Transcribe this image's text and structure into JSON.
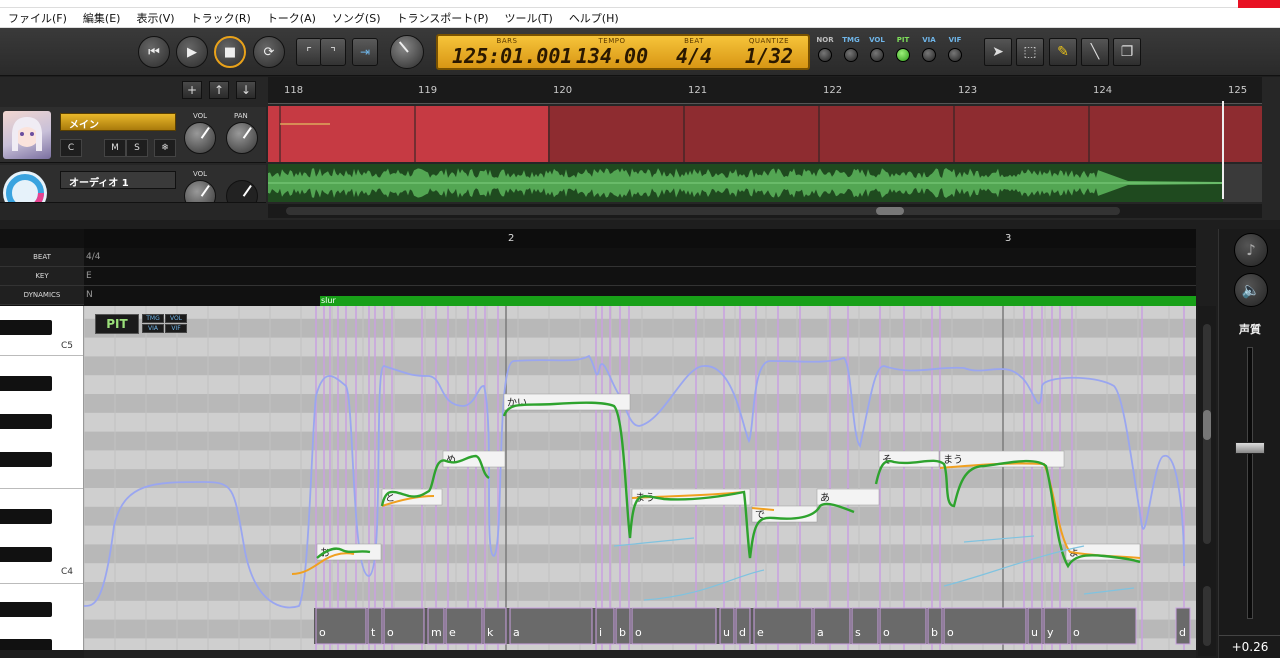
{
  "window": {
    "menu": [
      "ファイル(F)",
      "編集(E)",
      "表示(V)",
      "トラック(R)",
      "トーク(A)",
      "ソング(S)",
      "トランスポート(P)",
      "ツール(T)",
      "ヘルプ(H)"
    ]
  },
  "transport": {
    "lcd": {
      "bars_label": "BARS",
      "bars_value": "125:01.001",
      "tempo_label": "TEMPO",
      "tempo_value": "134.00",
      "beat_label": "BEAT",
      "beat_value": "4/4",
      "quantize_label": "QUANTIZE",
      "quantize_value": "1/32"
    },
    "switches": [
      {
        "label": "NOR",
        "color": "#bdbdbd",
        "on": false
      },
      {
        "label": "TMG",
        "color": "#6fb5e8",
        "on": false
      },
      {
        "label": "VOL",
        "color": "#6fb5e8",
        "on": false
      },
      {
        "label": "PIT",
        "color": "#7ee05a",
        "on": true
      },
      {
        "label": "VIA",
        "color": "#6fb5e8",
        "on": false
      },
      {
        "label": "VIF",
        "color": "#6fb5e8",
        "on": false
      }
    ]
  },
  "timeline": {
    "bars": [
      "118",
      "119",
      "120",
      "121",
      "122",
      "123",
      "124",
      "125"
    ]
  },
  "tracks": [
    {
      "name": "メイン",
      "buttons": [
        "C",
        "M",
        "S",
        "❄"
      ],
      "vol_label": "VOL",
      "pan_label": "PAN",
      "color": "#b02a35"
    },
    {
      "name": "オーディオ 1",
      "vol_label": "VOL",
      "color": "#2f7a2f"
    }
  ],
  "editor": {
    "beat_label": "BEAT",
    "beat_value": "4/4",
    "key_label": "KEY",
    "key_value": "E",
    "dynamics_label": "DYNAMICS",
    "dynamics_value": "N",
    "measures": [
      "2",
      "3"
    ],
    "slur_label": "slur",
    "pit_label": "PIT",
    "mini_modes": [
      "TMG",
      "VOL",
      "VIA",
      "VIF"
    ],
    "key_labels": [
      "C5",
      "C4"
    ],
    "notes": [
      {
        "lyric": "お"
      },
      {
        "lyric": "と"
      },
      {
        "lyric": "め"
      },
      {
        "lyric": "かい"
      },
      {
        "lyric": "まう"
      },
      {
        "lyric": "で"
      },
      {
        "lyric": "あ"
      },
      {
        "lyric": "そ"
      },
      {
        "lyric": "まう"
      },
      {
        "lyric": "よ"
      }
    ],
    "phonemes": [
      "o",
      "t",
      "o",
      "m",
      "e",
      "k",
      "a",
      "i",
      "b",
      "o",
      "u",
      "d",
      "e",
      "a",
      "s",
      "o",
      "b",
      "o",
      "u",
      "y",
      "o",
      "d"
    ]
  },
  "right_panel": {
    "voice_label": "声質",
    "value": "+0.26"
  }
}
